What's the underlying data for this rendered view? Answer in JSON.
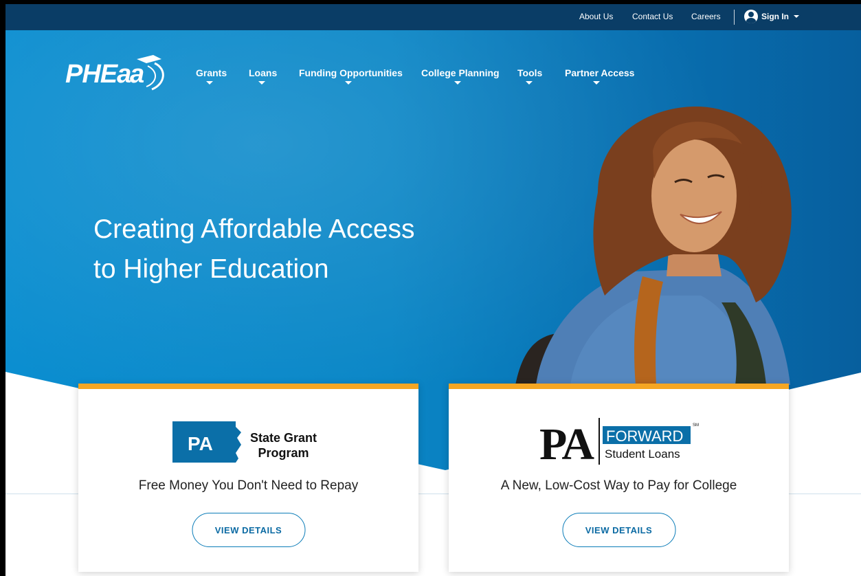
{
  "utility": {
    "links": [
      "About Us",
      "Contact Us",
      "Careers"
    ],
    "signin_label": "Sign In"
  },
  "logo": {
    "text": "PHEAA"
  },
  "nav": {
    "items": [
      {
        "label": "Grants",
        "dropdown": true
      },
      {
        "label": "Loans",
        "dropdown": true
      },
      {
        "label": "Funding Opportunities",
        "dropdown": true
      },
      {
        "label": "College Planning",
        "dropdown": true
      },
      {
        "label": "Tools",
        "dropdown": true
      },
      {
        "label": "Partner Access",
        "dropdown": true
      }
    ]
  },
  "hero": {
    "headline_line1": "Creating Affordable Access",
    "headline_line2": "to Higher Education"
  },
  "cards": [
    {
      "badge_text": "PA",
      "title_line1": "State Grant",
      "title_line2": "Program",
      "tagline": "Free Money You Don't Need to Repay",
      "button_label": "VIEW DETAILS"
    },
    {
      "logo_main": "PA",
      "logo_word": "FORWARD",
      "logo_sub": "Student Loans",
      "logo_mark": "SM",
      "tagline": "A New, Low-Cost Way to Pay for College",
      "button_label": "VIEW DETAILS"
    }
  ],
  "colors": {
    "utility_bar": "#0a3d66",
    "hero_blue": "#0a86c6",
    "card_accent": "#f5a623",
    "button_border": "#0b7cb8",
    "pa_blue": "#0b6fa8"
  },
  "icons": {
    "signin": "user-circle-icon",
    "nav_dropdown": "caret-down-icon"
  }
}
